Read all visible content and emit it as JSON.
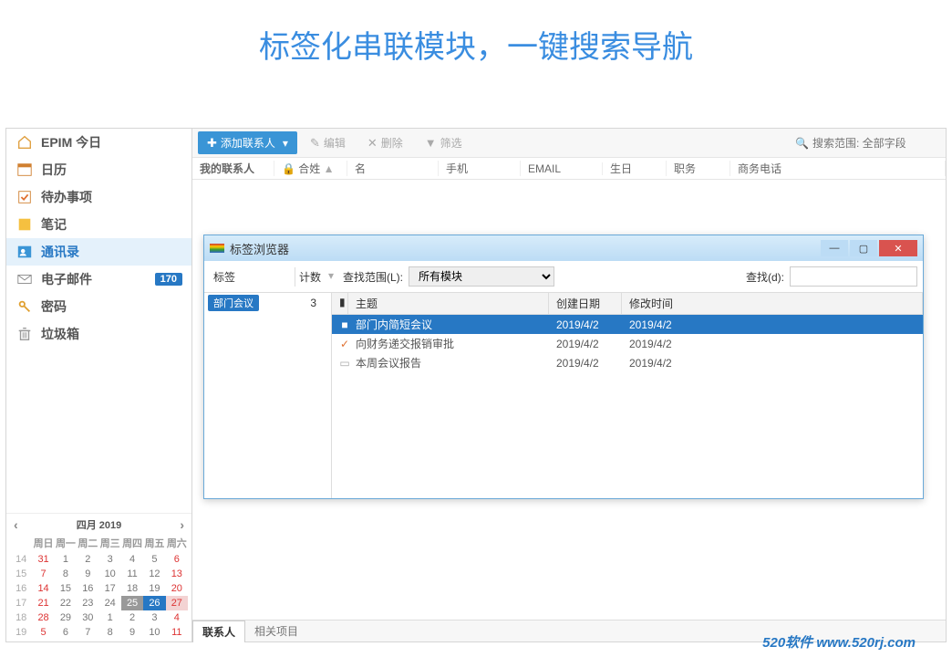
{
  "banner": "标签化串联模块，一键搜索导航",
  "sidebar": {
    "items": [
      {
        "label": "EPIM 今日",
        "icon": "home"
      },
      {
        "label": "日历",
        "icon": "calendar"
      },
      {
        "label": "待办事项",
        "icon": "todo"
      },
      {
        "label": "笔记",
        "icon": "note"
      },
      {
        "label": "通讯录",
        "icon": "contacts"
      },
      {
        "label": "电子邮件",
        "icon": "mail",
        "badge": "170"
      },
      {
        "label": "密码",
        "icon": "key"
      },
      {
        "label": "垃圾箱",
        "icon": "trash"
      }
    ]
  },
  "calendar": {
    "title_month": "四月",
    "title_year": "2019",
    "dow": [
      "周日",
      "周一",
      "周二",
      "周三",
      "周四",
      "周五",
      "周六"
    ],
    "weeks": [
      {
        "wk": "14",
        "days": [
          "31",
          "1",
          "2",
          "3",
          "4",
          "5",
          "6"
        ]
      },
      {
        "wk": "15",
        "days": [
          "7",
          "8",
          "9",
          "10",
          "11",
          "12",
          "13"
        ]
      },
      {
        "wk": "16",
        "days": [
          "14",
          "15",
          "16",
          "17",
          "18",
          "19",
          "20"
        ]
      },
      {
        "wk": "17",
        "days": [
          "21",
          "22",
          "23",
          "24",
          "25",
          "26",
          "27"
        ]
      },
      {
        "wk": "18",
        "days": [
          "28",
          "29",
          "30",
          "1",
          "2",
          "3",
          "4"
        ]
      },
      {
        "wk": "19",
        "days": [
          "5",
          "6",
          "7",
          "8",
          "9",
          "10",
          "11"
        ]
      }
    ]
  },
  "toolbar": {
    "add": "添加联系人",
    "edit": "编辑",
    "delete": "删除",
    "filter": "筛选",
    "search_prefix": "搜索范围: 全部字段"
  },
  "columns": {
    "c0": "我的联系人",
    "c1": "合姓",
    "c2": "名",
    "c3": "手机",
    "c4": "EMAIL",
    "c5": "生日",
    "c6": "职务",
    "c7": "商务电话"
  },
  "dialog": {
    "title": "标签浏览器",
    "tag_col": "标签",
    "count_col": "计数",
    "scope_label": "查找范围(L):",
    "scope_value": "所有模块",
    "find_label": "查找(d):",
    "tag_name": "部门会议",
    "tag_count": "3",
    "list_cols": {
      "subject": "主题",
      "created": "创建日期",
      "modified": "修改时间"
    },
    "rows": [
      {
        "icon": "■",
        "subject": "部门内简短会议",
        "created": "2019/4/2",
        "modified": "2019/4/2"
      },
      {
        "icon": "✓",
        "subject": "向财务递交报销审批",
        "created": "2019/4/2",
        "modified": "2019/4/2"
      },
      {
        "icon": "▭",
        "subject": "本周会议报告",
        "created": "2019/4/2",
        "modified": "2019/4/2"
      }
    ]
  },
  "bottom_tabs": {
    "contacts": "联系人",
    "related": "相关项目"
  },
  "footer": "520软件 www.520rj.com"
}
